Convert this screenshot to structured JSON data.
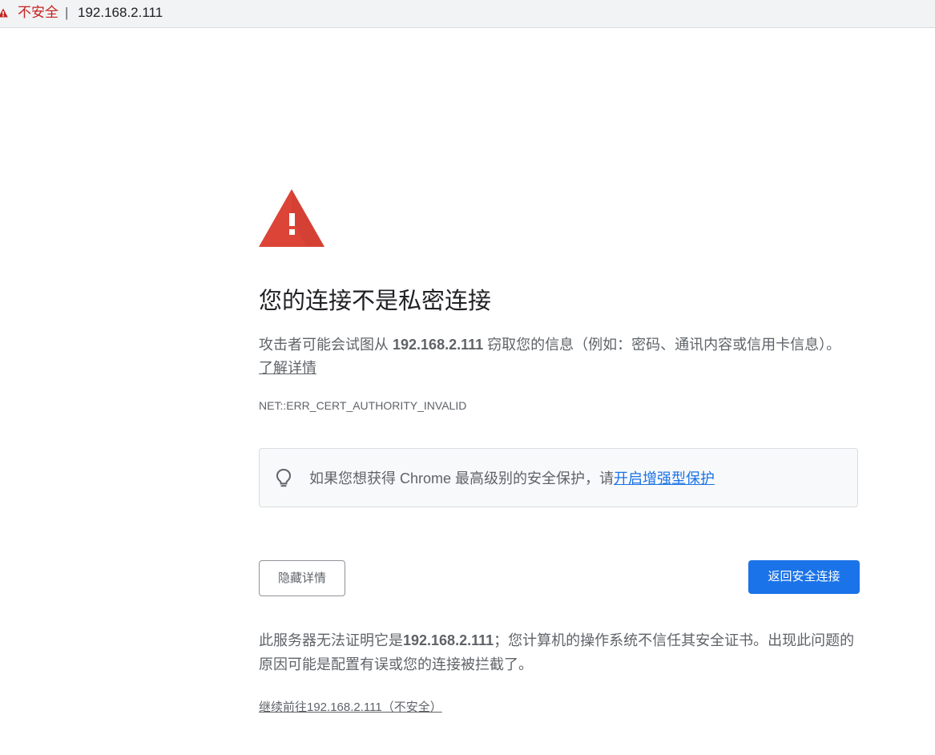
{
  "addressbar": {
    "insecure_label": "不安全",
    "separator": "|",
    "url": "192.168.2.111"
  },
  "interstitial": {
    "heading": "您的连接不是私密连接",
    "explanation_before": "攻击者可能会试图从 ",
    "host": "192.168.2.111",
    "explanation_after": " 窃取您的信息（例如：密码、通讯内容或信用卡信息）。",
    "learn_more_label": "了解详情",
    "error_code": "NET::ERR_CERT_AUTHORITY_INVALID",
    "promo_text": "如果您想获得 Chrome 最高级别的安全保护，请",
    "promo_link_label": "开启增强型保护",
    "hide_details_label": "隐藏详情",
    "back_to_safety_label": "返回安全连接",
    "details_before": "此服务器无法证明它是",
    "details_host": "192.168.2.111",
    "details_after": "；您计算机的操作系统不信任其安全证书。出现此问题的原因可能是配置有误或您的连接被拦截了。",
    "proceed_label": "继续前往192.168.2.111（不安全）"
  },
  "colors": {
    "danger_red": "#db4437",
    "insecure_red": "#c5221f",
    "link_blue": "#1a73e8",
    "primary_button": "#1a73e8",
    "secondary_text": "#5f6368"
  },
  "icons": {
    "address_warning": "warning-triangle-icon",
    "main_danger": "danger-triangle-icon",
    "promo": "lightbulb-icon"
  }
}
